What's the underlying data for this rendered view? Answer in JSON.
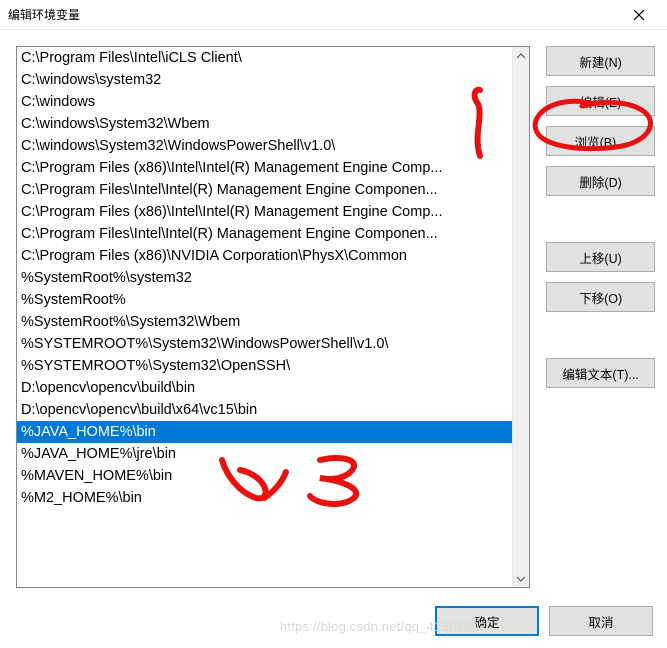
{
  "window": {
    "title": "编辑环境变量"
  },
  "list": {
    "items": [
      "C:\\Program Files\\Intel\\iCLS Client\\",
      "C:\\windows\\system32",
      "C:\\windows",
      "C:\\windows\\System32\\Wbem",
      "C:\\windows\\System32\\WindowsPowerShell\\v1.0\\",
      "C:\\Program Files (x86)\\Intel\\Intel(R) Management Engine Comp...",
      "C:\\Program Files\\Intel\\Intel(R) Management Engine Componen...",
      "C:\\Program Files (x86)\\Intel\\Intel(R) Management Engine Comp...",
      "C:\\Program Files\\Intel\\Intel(R) Management Engine Componen...",
      "C:\\Program Files (x86)\\NVIDIA Corporation\\PhysX\\Common",
      "%SystemRoot%\\system32",
      "%SystemRoot%",
      "%SystemRoot%\\System32\\Wbem",
      "%SYSTEMROOT%\\System32\\WindowsPowerShell\\v1.0\\",
      "%SYSTEMROOT%\\System32\\OpenSSH\\",
      "D:\\opencv\\opencv\\build\\bin",
      "D:\\opencv\\opencv\\build\\x64\\vc15\\bin",
      "%JAVA_HOME%\\bin",
      "%JAVA_HOME%\\jre\\bin",
      "%MAVEN_HOME%\\bin",
      "%M2_HOME%\\bin"
    ],
    "selected_index": 17
  },
  "buttons": {
    "new": "新建(N)",
    "edit": "编辑(E)",
    "browse": "浏览(B)...",
    "delete": "删除(D)",
    "move_up": "上移(U)",
    "move_down": "下移(O)",
    "edit_text": "编辑文本(T)...",
    "ok": "确定",
    "cancel": "取消"
  },
  "watermark": "https://blog.csdn.net/qq_41502502",
  "annotations": {
    "color": "#e91010"
  }
}
